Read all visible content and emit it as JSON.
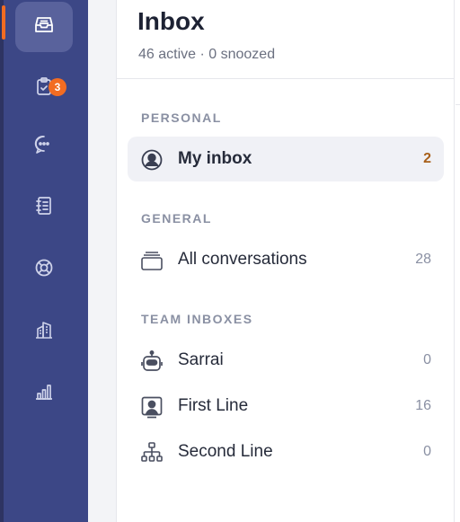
{
  "colors": {
    "rail": "#3c4786",
    "rail_active": "#59629c",
    "accent": "#f26c22",
    "selected_row": "#f0f1f6",
    "selected_count": "#a8601a"
  },
  "rail": {
    "items": [
      {
        "icon": "inbox-icon",
        "active": true
      },
      {
        "icon": "clipboard-check-icon",
        "badge": "3"
      },
      {
        "icon": "chat-bubble-icon"
      },
      {
        "icon": "notebook-icon"
      },
      {
        "icon": "lifebuoy-icon"
      },
      {
        "icon": "buildings-icon"
      },
      {
        "icon": "bar-chart-icon"
      }
    ]
  },
  "inbox": {
    "title": "Inbox",
    "subtitle": "46 active · 0 snoozed"
  },
  "sections": {
    "personal": {
      "label": "PERSONAL",
      "items": [
        {
          "label": "My inbox",
          "count": "2",
          "icon": "user-circle-icon",
          "selected": true
        }
      ]
    },
    "general": {
      "label": "GENERAL",
      "items": [
        {
          "label": "All conversations",
          "count": "28",
          "icon": "stacked-trays-icon"
        }
      ]
    },
    "team": {
      "label": "TEAM INBOXES",
      "items": [
        {
          "label": "Sarrai",
          "count": "0",
          "icon": "robot-icon"
        },
        {
          "label": "First Line",
          "count": "16",
          "icon": "user-frame-icon"
        },
        {
          "label": "Second Line",
          "count": "0",
          "icon": "org-chart-icon"
        }
      ]
    }
  }
}
